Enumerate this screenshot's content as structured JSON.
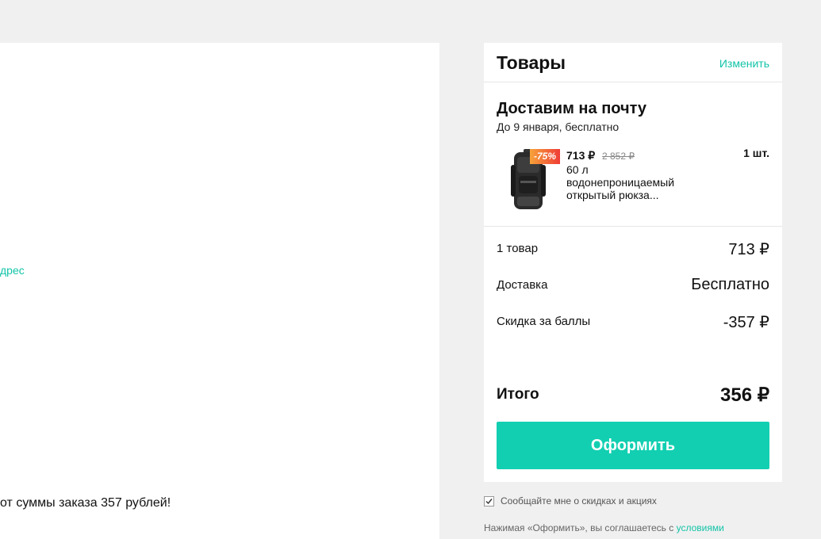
{
  "left": {
    "address_link_fragment": "дрес",
    "bonus_note_fragment": "от суммы заказа 357 рублей!"
  },
  "cart": {
    "title": "Товары",
    "edit_label": "Изменить",
    "delivery_title": "Доставим на почту",
    "delivery_subtitle": "До 9 января, бесплатно",
    "item": {
      "discount": "-75%",
      "price": "713 ₽",
      "old_price": "2 852 ₽",
      "name": "60 л водонепроницаемый открытый рюкза...",
      "quantity": "1 шт."
    },
    "summary": {
      "items_label": "1 товар",
      "items_value": "713 ₽",
      "delivery_label": "Доставка",
      "delivery_value": "Бесплатно",
      "points_label": "Скидка за баллы",
      "points_value": "-357 ₽",
      "total_label": "Итого",
      "total_value": "356 ₽"
    },
    "checkout_label": "Оформить"
  },
  "footer": {
    "subscribe_label": "Сообщайте мне о скидках и акциях",
    "subscribe_checked": true,
    "terms_text": "Нажимая «Оформить», вы соглашаетесь с",
    "terms_link": "условиями"
  },
  "colors": {
    "accent": "#12cfb1",
    "link": "#12c4a8",
    "badge_from": "#f7a33a",
    "badge_to": "#ef3d36"
  }
}
